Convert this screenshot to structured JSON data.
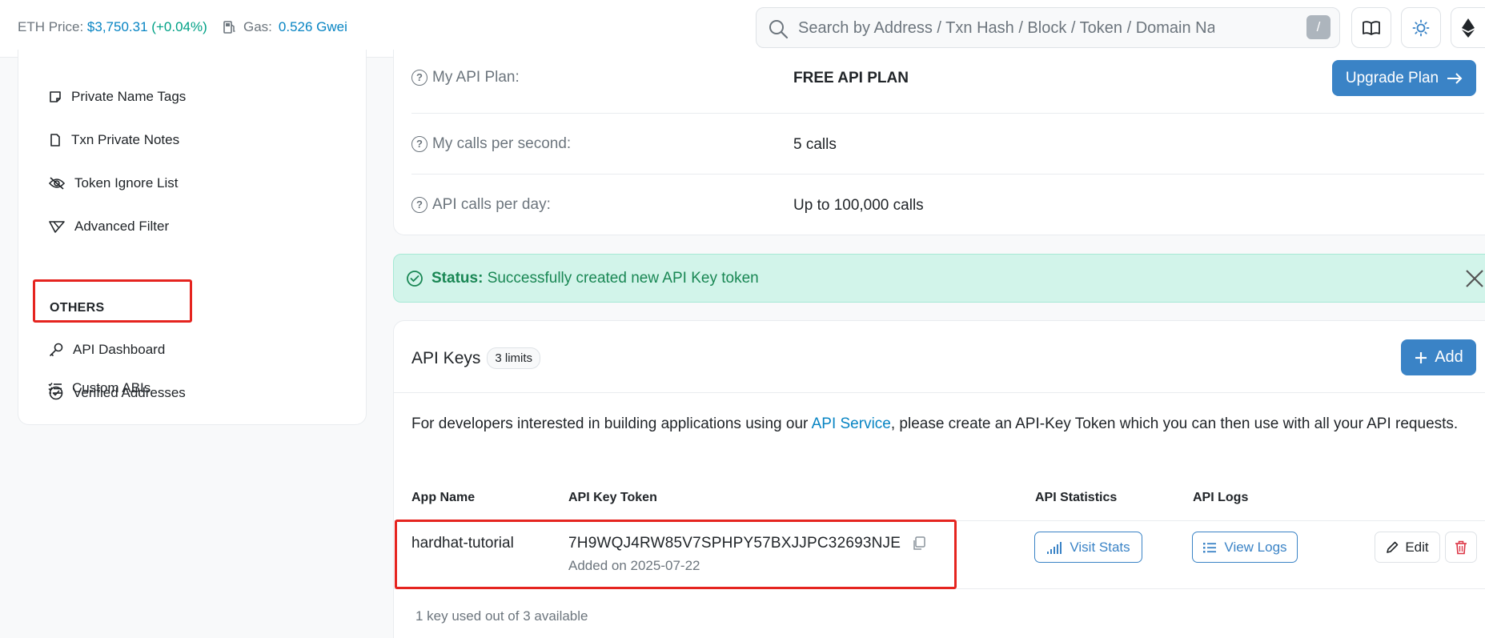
{
  "topbar": {
    "eth_price_label": "ETH Price:",
    "eth_price_value": "$3,750.31",
    "eth_price_change": "(+0.04%)",
    "gas_label": "Gas:",
    "gas_value": "0.526 Gwei",
    "search_placeholder": "Search by Address / Txn Hash / Block / Token / Domain Name",
    "search_shortcut": "/"
  },
  "sidebar": {
    "items": [
      {
        "label": "Private Name Tags"
      },
      {
        "label": "Txn Private Notes"
      },
      {
        "label": "Token Ignore List"
      },
      {
        "label": "Advanced Filter"
      }
    ],
    "section_others": "OTHERS",
    "others_items": [
      {
        "label": "API Dashboard"
      },
      {
        "label": "Verified Addresses"
      },
      {
        "label": "Custom ABIs"
      }
    ]
  },
  "plan": {
    "rows": [
      {
        "label": "My API Plan:",
        "value": "FREE API PLAN"
      },
      {
        "label": "My calls per second:",
        "value": "5 calls"
      },
      {
        "label": "API calls per day:",
        "value": "Up to 100,000 calls"
      }
    ],
    "upgrade_label": "Upgrade Plan"
  },
  "status": {
    "prefix": "Status:",
    "message": "Successfully created new API Key token"
  },
  "api_keys": {
    "title": "API Keys",
    "limits_badge": "3 limits",
    "add_label": "Add",
    "intro_before": "For developers interested in building applications using our ",
    "intro_link": "API Service",
    "intro_after": ", please create an API-Key Token which you can then use with all your API requests.",
    "columns": [
      "App Name",
      "API Key Token",
      "API Statistics",
      "API Logs"
    ],
    "rows": [
      {
        "app_name": "hardhat-tutorial",
        "token": "7H9WQJ4RW85V7SPHPY57BXJJPC32693NJE",
        "added": "Added on 2025-07-22",
        "stats_label": "Visit Stats",
        "logs_label": "View Logs",
        "edit_label": "Edit"
      }
    ],
    "usage": "1 key used out of 3 available"
  },
  "colors": {
    "accent": "#3a83c6",
    "link": "#0784c3",
    "success_bg": "#d2f4ea",
    "success_text": "#198754",
    "highlight": "#e5241f",
    "danger": "#dc3545"
  }
}
